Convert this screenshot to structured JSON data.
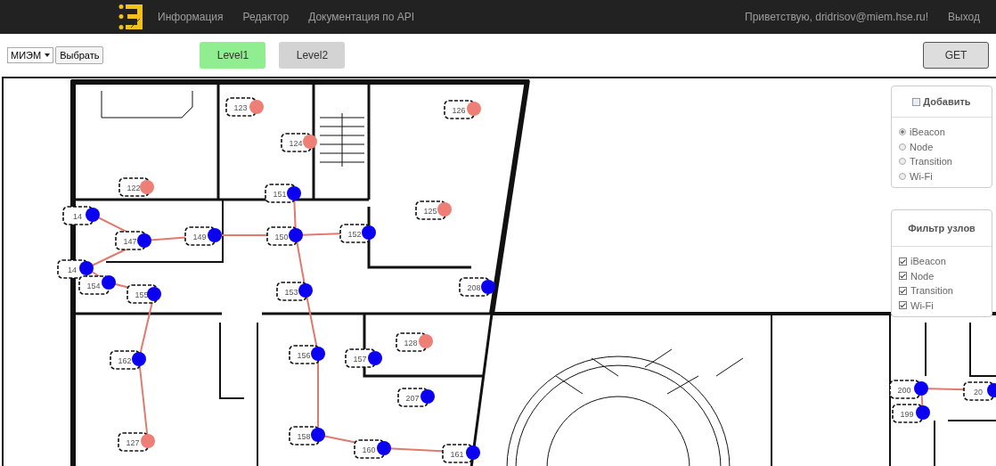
{
  "header": {
    "nav": [
      "Информация",
      "Редактор",
      "Документация по API"
    ],
    "greeting": "Приветствую, dridrisov@miem.hse.ru!",
    "logout": "Выход"
  },
  "toolbar": {
    "site_select": "МИЭМ",
    "select_button": "Выбрать",
    "levels": [
      {
        "label": "Level1",
        "selected": true
      },
      {
        "label": "Level2",
        "selected": false
      }
    ],
    "get_button": "GET"
  },
  "add_panel": {
    "title": "Добавить",
    "checked": false,
    "options": [
      {
        "label": "iBeacon",
        "selected": true
      },
      {
        "label": "Node",
        "selected": false
      },
      {
        "label": "Transition",
        "selected": false
      },
      {
        "label": "Wi-Fi",
        "selected": false
      }
    ]
  },
  "filter_panel": {
    "title": "Фильтр узлов",
    "options": [
      {
        "label": "iBeacon",
        "checked": true
      },
      {
        "label": "Node",
        "checked": true
      },
      {
        "label": "Transition",
        "checked": true
      },
      {
        "label": "Wi-Fi",
        "checked": true
      }
    ]
  },
  "map": {
    "nodes": [
      {
        "label": "123",
        "kind": "ibeacon"
      },
      {
        "label": "124",
        "kind": "ibeacon"
      },
      {
        "label": "126",
        "kind": "ibeacon"
      },
      {
        "label": "122",
        "kind": "ibeacon"
      },
      {
        "label": "125",
        "kind": "ibeacon"
      },
      {
        "label": "151",
        "kind": "node"
      },
      {
        "label": "14",
        "kind": "node"
      },
      {
        "label": "147",
        "kind": "node"
      },
      {
        "label": "149",
        "kind": "node"
      },
      {
        "label": "150",
        "kind": "node"
      },
      {
        "label": "152",
        "kind": "node"
      },
      {
        "label": "14",
        "kind": "node"
      },
      {
        "label": "154",
        "kind": "node"
      },
      {
        "label": "155",
        "kind": "node"
      },
      {
        "label": "153",
        "kind": "node"
      },
      {
        "label": "208",
        "kind": "node"
      },
      {
        "label": "162",
        "kind": "node"
      },
      {
        "label": "156",
        "kind": "node"
      },
      {
        "label": "157",
        "kind": "node"
      },
      {
        "label": "128",
        "kind": "ibeacon"
      },
      {
        "label": "207",
        "kind": "node"
      },
      {
        "label": "127",
        "kind": "ibeacon"
      },
      {
        "label": "158",
        "kind": "node"
      },
      {
        "label": "160",
        "kind": "node"
      },
      {
        "label": "161",
        "kind": "node"
      },
      {
        "label": "200",
        "kind": "node"
      },
      {
        "label": "199",
        "kind": "node"
      },
      {
        "label": "20",
        "kind": "node"
      }
    ]
  }
}
